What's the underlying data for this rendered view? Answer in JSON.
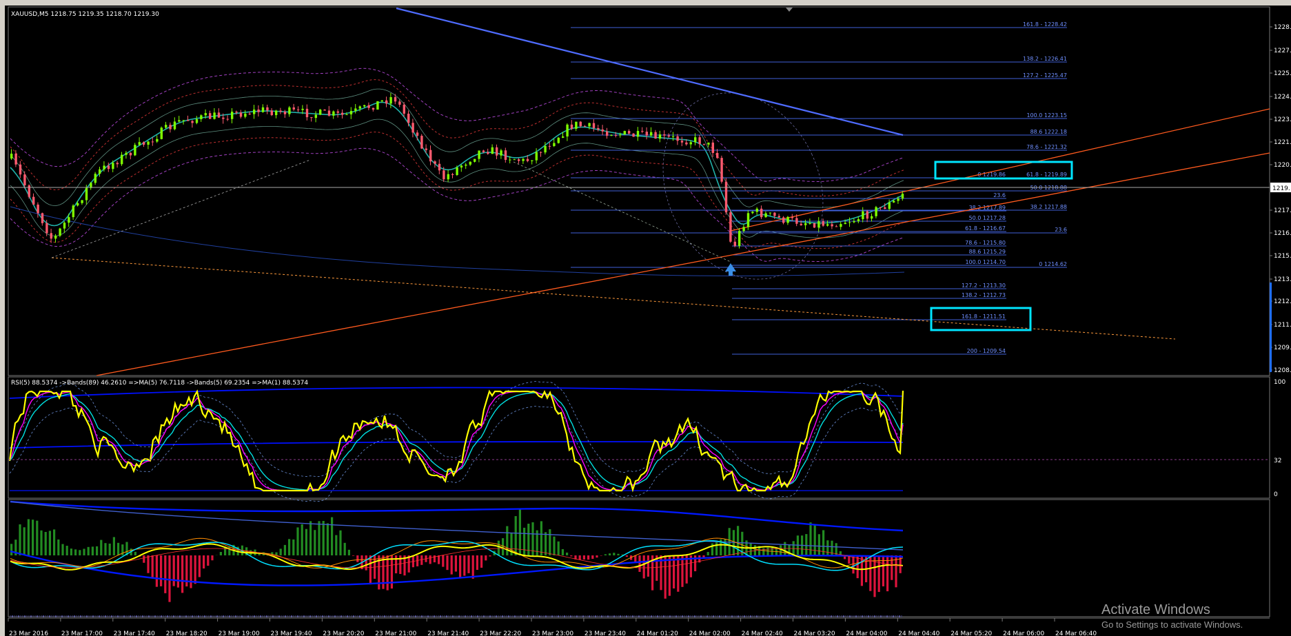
{
  "symbol_header": "XAUUSD,M5  1218.75 1219.35 1218.70 1219.30",
  "price_axis": [
    "1228.4",
    "1227.",
    "1225.",
    "1224.",
    "1223.",
    "1221.",
    "1220.",
    "1219.",
    "1217.",
    "1216.",
    "1215.",
    "1213.",
    "1212.",
    "1211.",
    "1209.",
    "1208."
  ],
  "current_price_label": "1219.",
  "fib_labels": [
    "161.8 - 1228.42",
    "138.2 - 1226.41",
    "127.2 - 1225.47",
    "100.0 1223.15",
    "88.6 1222.18",
    "78.6 - 1221.32",
    "0 1219.86",
    "61.8 - 1219.89",
    "50.0 1218.88",
    "23.6",
    "38.2 1217.89",
    "38.2 1217.88",
    "50.0 1217.28",
    "61.8 - 1216.67",
    "23.6",
    "78.6 - 1215.80",
    "88.6 1215.29",
    "100.0 1214.70",
    "0 1214.62",
    "127.2 - 1213.30",
    "138.2 - 1212.73",
    "161.8 - 1211.51",
    "200 - 1209.54"
  ],
  "rsi_header": "RSI(5) 88.5374  ->Bands(89) 46.2610  =>MA(5) 76.7118  ->Bands(5) 69.2354  =>MA(1) 88.5374",
  "rsi_axis": [
    "100",
    "32",
    "0"
  ],
  "time_axis": [
    "23 Mar 2016",
    "23 Mar 17:00",
    "23 Mar 17:40",
    "23 Mar 18:20",
    "23 Mar 19:00",
    "23 Mar 19:40",
    "23 Mar 20:20",
    "23 Mar 21:00",
    "23 Mar 21:40",
    "23 Mar 22:20",
    "23 Mar 23:00",
    "23 Mar 23:40",
    "24 Mar 01:20",
    "24 Mar 02:00",
    "24 Mar 02:40",
    "24 Mar 03:20",
    "24 Mar 04:00",
    "24 Mar 04:40",
    "24 Mar 05:20",
    "24 Mar 06:00",
    "24 Mar 06:40"
  ],
  "watermark": {
    "title": "Activate Windows",
    "subtitle": "Go to Settings to activate Windows."
  },
  "colors": {
    "bull_candle": "#7fff00",
    "bear_candle": "#ff5a6e",
    "fib_line": "#3f5fd8",
    "trend_orange": "#ff5a1e",
    "trend_blue": "#4f6cff",
    "highlight_box": "#00e5ff",
    "rsi_line": "#ffff00",
    "hist_up": "#228b22",
    "hist_down": "#dc143c"
  }
}
